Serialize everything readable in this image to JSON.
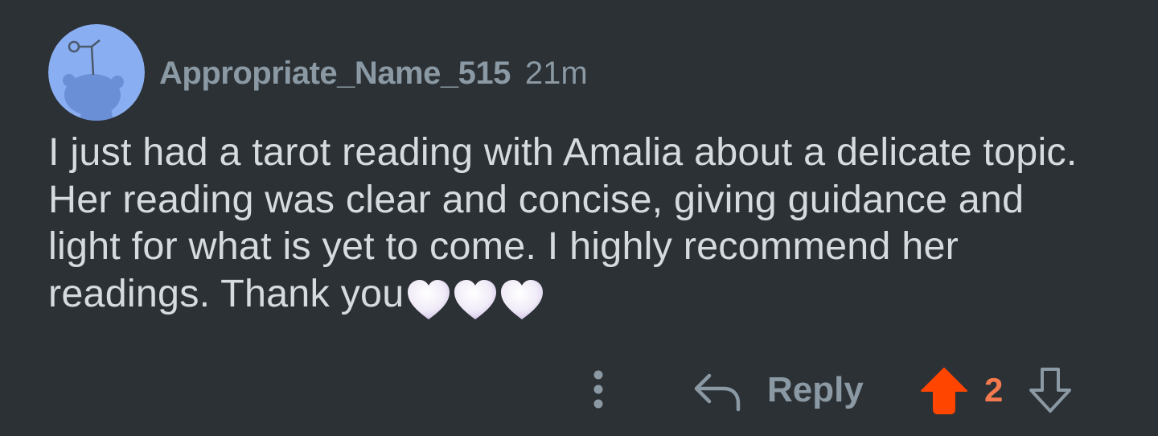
{
  "comment": {
    "username": "Appropriate_Name_515",
    "timestamp": "21m",
    "body": "I just had a tarot reading with Amalia about a delicate topic. Her reading was clear and concise, giving guidance and light for what is yet to come. I highly recommend her readings. Thank you",
    "emoji_trailer": [
      "white-heart",
      "white-heart",
      "white-heart"
    ],
    "avatar_icon": "snoo-avatar-icon",
    "avatar_bg": "#8aaef2"
  },
  "actions": {
    "more_icon": "vertical-dots-icon",
    "reply_icon": "reply-arrow-icon",
    "reply_label": "Reply",
    "upvote_icon": "upvote-arrow-icon",
    "upvote_state": "upvoted",
    "score": "2",
    "downvote_icon": "downvote-arrow-icon"
  },
  "colors": {
    "background": "#2c3135",
    "meta_text": "#8a99a3",
    "body_text": "#d6dbdf",
    "upvote_active": "#ff4500",
    "score_active": "#f37a4e"
  }
}
